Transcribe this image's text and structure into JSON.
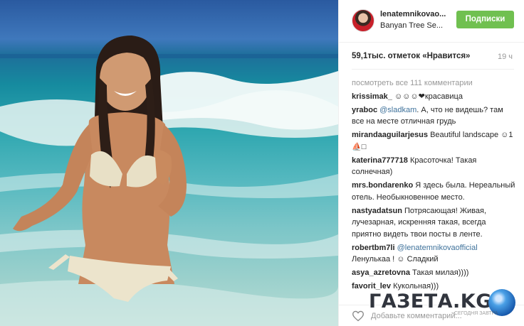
{
  "post": {
    "username": "lenatemnikovao...",
    "location": "Banyan Tree Se...",
    "follow_label": "Подписки",
    "likes": "59,1тыс. отметок «Нравится»",
    "time": "19 ч",
    "view_all": "посмотреть все 111 комментарии",
    "add_comment_placeholder": "Добавьте комментарий..."
  },
  "comments": [
    {
      "user": "krissimak_",
      "mention": "",
      "text": " ☺☺☺❤красавица"
    },
    {
      "user": "yraboc",
      "mention": "@sladkam",
      "text": ". А, что не видешь? там все на месте отличная грудь"
    },
    {
      "user": "mirandaaguilarjesus",
      "mention": "",
      "text": " Beautiful landscape ☺1⛵□"
    },
    {
      "user": "katerina777718",
      "mention": "",
      "text": " Красоточка! Такая солнечная)"
    },
    {
      "user": "mrs.bondarenko",
      "mention": "",
      "text": " Я здесь была. Нереальный отель. Необыкновенное место."
    },
    {
      "user": "nastyadatsun",
      "mention": "",
      "text": " Потрясающая! Живая, лучезарная, искренняя такая, всегда приятно видеть твои посты в ленте."
    },
    {
      "user": "robertbm7li",
      "mention": "@lenatemnikovaofficial",
      "text": " Ленулькаа ! ☺ Сладкий"
    },
    {
      "user": "asya_azretovna",
      "mention": "",
      "text": " Такая милая))))"
    },
    {
      "user": "favorit_lev",
      "mention": "",
      "text": " Кукольная)))"
    }
  ],
  "watermark": {
    "text": "ГАЗЕТА.",
    "kg": "KG",
    "sub": "СЕГОДНЯ ЗАВТРА"
  },
  "colors": {
    "follow": "#70c050",
    "mention": "#3f729b",
    "muted": "#999999"
  },
  "icons": {
    "heart": "heart-outline-icon",
    "watermark_globe": "globe-icon"
  }
}
